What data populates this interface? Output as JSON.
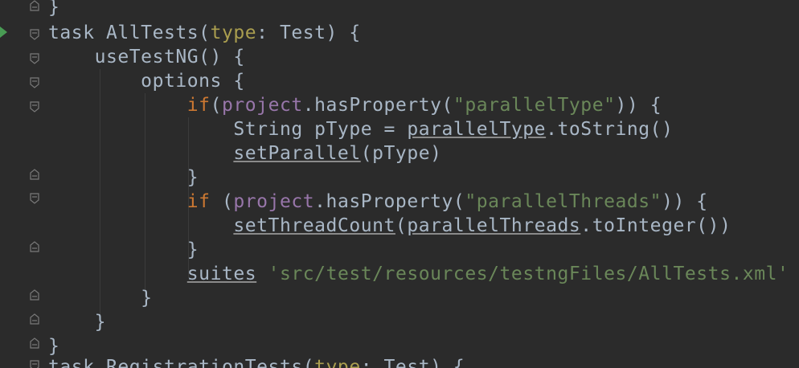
{
  "editor": {
    "colors": {
      "background": "#2b2b2b",
      "text": "#a9b7c6",
      "keyword": "#cc7832",
      "string": "#6a8759",
      "property": "#9876aa",
      "run_gutter": "#499c54"
    },
    "gutter": {
      "run_icon": "run-arrow-icon",
      "fold_icon": "fold-marker-icon"
    },
    "lines": [
      {
        "t0": "}"
      },
      {
        "t0": "task AllTests(",
        "t1": "type",
        "t2": ": Test) {"
      },
      {
        "t0": "    useTestNG() {"
      },
      {
        "t0": "        options {"
      },
      {
        "t0": "            ",
        "t1": "if",
        "t2": "(",
        "t3": "project",
        "t4": ".hasProperty(",
        "t5": "\"parallelType\"",
        "t6": ")) {"
      },
      {
        "t0": "                String pType = ",
        "t1": "parallelType",
        "t2": ".toString()"
      },
      {
        "t0": "                ",
        "t1": "setParallel",
        "t2": "(pType)"
      },
      {
        "t0": "            }"
      },
      {
        "t0": "            ",
        "t1": "if",
        "t2": " (",
        "t3": "project",
        "t4": ".hasProperty(",
        "t5": "\"parallelThreads\"",
        "t6": ")) {"
      },
      {
        "t0": "                ",
        "t1": "setThreadCount",
        "t2": "(",
        "t3": "parallelThreads",
        "t4": ".toInteger())"
      },
      {
        "t0": "            }"
      },
      {
        "t0": "            ",
        "t1": "suites",
        "t2": " ",
        "t3": "'src/test/resources/testngFiles/AllTests.xml'"
      },
      {
        "t0": "        }"
      },
      {
        "t0": "    }"
      },
      {
        "t0": "}"
      },
      {
        "t0": "task RegistrationTests(",
        "t1": "type",
        "t2": ": Test) {"
      }
    ]
  }
}
